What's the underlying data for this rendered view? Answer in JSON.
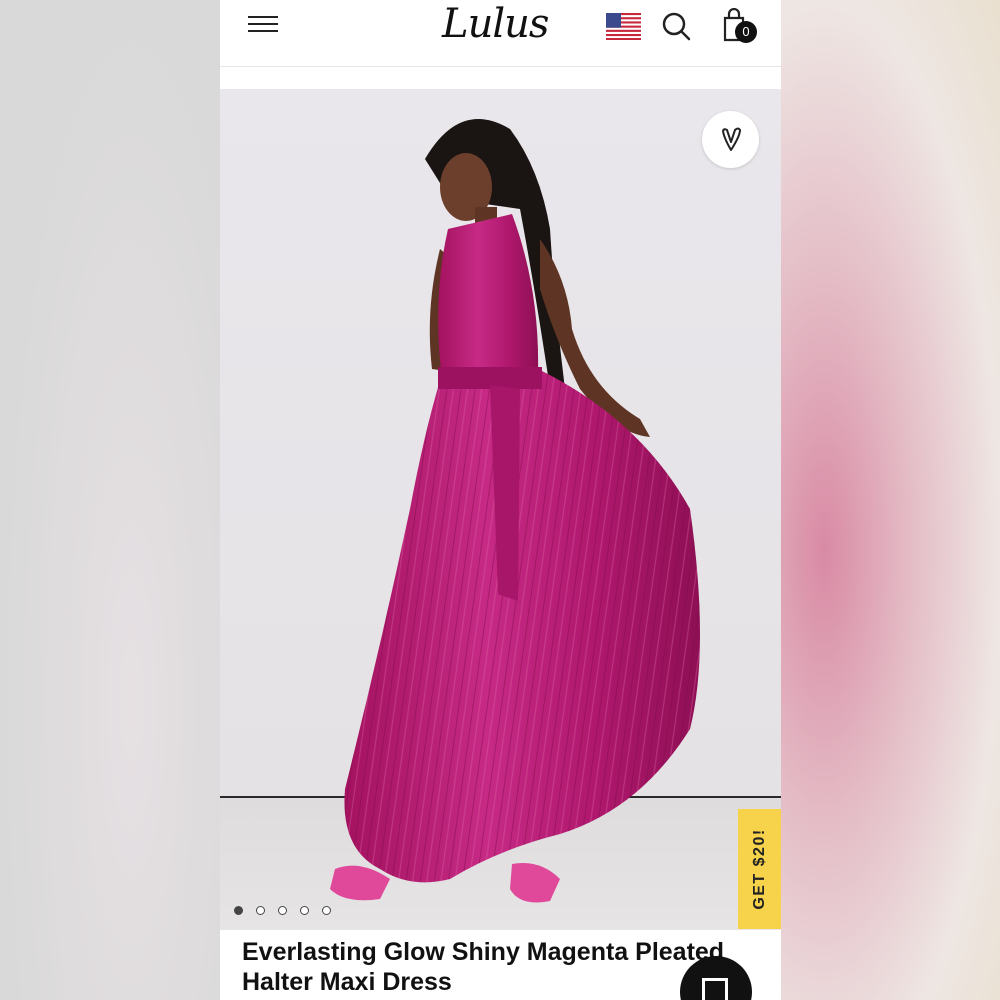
{
  "header": {
    "logo_text": "Lulus",
    "cart_count": "0",
    "icons": [
      "hamburger-menu-icon",
      "us-flag-icon",
      "search-icon",
      "shopping-bag-icon"
    ]
  },
  "product": {
    "title": "Everlasting Glow Shiny Magenta Pleated Halter Maxi Dress",
    "image_count": 5,
    "active_image_index": 0,
    "dress_color": "#b0186e"
  },
  "promo": {
    "label": "GET $20!",
    "color": "#f6d34a"
  },
  "icons": {
    "wishlist": "heart-icon",
    "chat": "chat-icon"
  }
}
